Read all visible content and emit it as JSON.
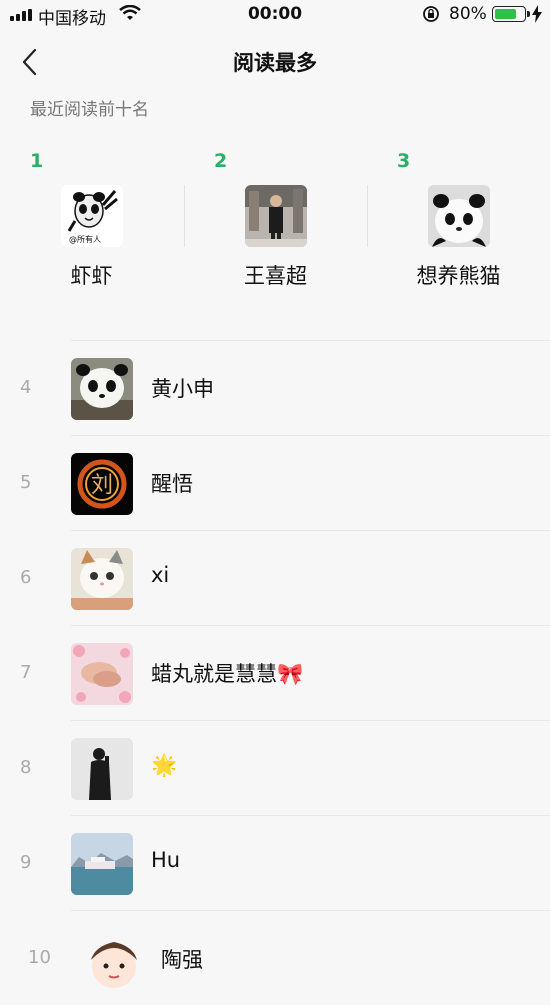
{
  "status_bar": {
    "carrier": "中国移动",
    "time": "00:00",
    "battery_pct": "80%",
    "battery_level": 0.8
  },
  "nav": {
    "back_icon": "chevron-left-icon",
    "title": "阅读最多"
  },
  "subtitle": "最近阅读前十名",
  "top3": [
    {
      "rank": "1",
      "name": "虾虾"
    },
    {
      "rank": "2",
      "name": "王喜超"
    },
    {
      "rank": "3",
      "name": "想养熊猫"
    }
  ],
  "list": [
    {
      "rank": "4",
      "name": "黄小申"
    },
    {
      "rank": "5",
      "name": "醒悟"
    },
    {
      "rank": "6",
      "name": "xi"
    },
    {
      "rank": "7",
      "name": "蜡丸就是慧慧🎀"
    },
    {
      "rank": "8",
      "name": "🌟"
    },
    {
      "rank": "9",
      "name": "Hu"
    },
    {
      "rank": "10",
      "name": "陶强"
    }
  ],
  "colors": {
    "accent": "#2bae66",
    "battery": "#2ec04a",
    "background": "#f7f7f7"
  }
}
